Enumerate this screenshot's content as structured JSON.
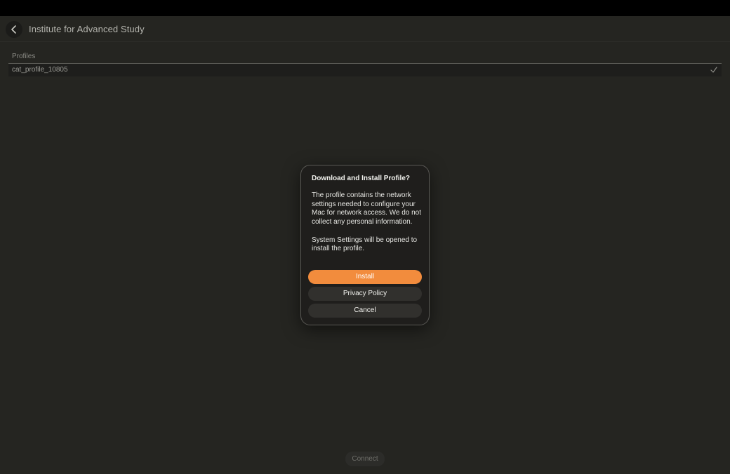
{
  "header": {
    "title": "Institute for Advanced Study",
    "back_icon": "chevron-left-icon"
  },
  "profiles": {
    "label": "Profiles",
    "items": [
      {
        "name": "cat_profile_10805",
        "selected": true,
        "icon": "checkmark-icon"
      }
    ]
  },
  "dialog": {
    "title": "Download and Install Profile?",
    "paragraphs": [
      "The profile contains the network settings needed to configure your Mac for network access. We do not collect any personal information.",
      "System Settings will be opened to install the profile."
    ],
    "buttons": {
      "install": "Install",
      "privacy": "Privacy Policy",
      "cancel": "Cancel"
    }
  },
  "footer": {
    "connect": "Connect"
  },
  "colors": {
    "accent": "#f28c3d",
    "background": "#252521",
    "dialog_background": "#1f1e1c"
  }
}
